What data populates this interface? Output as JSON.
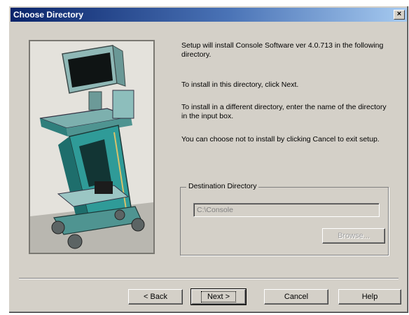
{
  "window": {
    "title": "Choose Directory",
    "close_glyph": "×"
  },
  "messages": {
    "line1": "Setup will install Console Software ver 4.0.713 in the following directory.",
    "line2": "To install in this directory, click Next.",
    "line3": "To install in a different directory, enter the name of the directory in the input box.",
    "line4": "You can choose not to install by clicking Cancel to exit setup."
  },
  "destination": {
    "group_label": "Destination Directory",
    "path": "C:\\Console",
    "browse_label": "Browse..."
  },
  "buttons": {
    "back": "< Back",
    "next": "Next >",
    "cancel": "Cancel",
    "help": "Help"
  },
  "colors": {
    "device_teal": "#2f9b98",
    "titlebar": "#0a246a"
  }
}
